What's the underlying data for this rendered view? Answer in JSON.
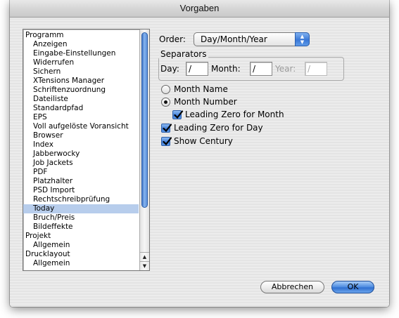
{
  "window": {
    "title": "Vorgaben"
  },
  "list": {
    "items": [
      {
        "label": "Programm",
        "level": 0
      },
      {
        "label": "Anzeigen",
        "level": 1
      },
      {
        "label": "Eingabe-Einstellungen",
        "level": 1
      },
      {
        "label": "Widerrufen",
        "level": 1
      },
      {
        "label": "Sichern",
        "level": 1
      },
      {
        "label": "XTensions Manager",
        "level": 1
      },
      {
        "label": "Schriftenzuordnung",
        "level": 1
      },
      {
        "label": "Dateiliste",
        "level": 1
      },
      {
        "label": "Standardpfad",
        "level": 1
      },
      {
        "label": "EPS",
        "level": 1
      },
      {
        "label": "Voll aufgelöste Voransicht",
        "level": 1
      },
      {
        "label": "Browser",
        "level": 1
      },
      {
        "label": "Index",
        "level": 1
      },
      {
        "label": "Jabberwocky",
        "level": 1
      },
      {
        "label": "Job Jackets",
        "level": 1
      },
      {
        "label": "PDF",
        "level": 1
      },
      {
        "label": "Platzhalter",
        "level": 1
      },
      {
        "label": "PSD Import",
        "level": 1
      },
      {
        "label": "Rechtschreibprüfung",
        "level": 1
      },
      {
        "label": "Today",
        "level": 1,
        "selected": true
      },
      {
        "label": "Bruch/Preis",
        "level": 1
      },
      {
        "label": "Bildeffekte",
        "level": 1
      },
      {
        "label": "Projekt",
        "level": 0
      },
      {
        "label": "Allgemein",
        "level": 1
      },
      {
        "label": "Drucklayout",
        "level": 0
      },
      {
        "label": "Allgemein",
        "level": 1
      }
    ]
  },
  "order": {
    "label": "Order:",
    "value": "Day/Month/Year"
  },
  "separators": {
    "title": "Separators",
    "day_label": "Day:",
    "day_value": "/",
    "month_label": "Month:",
    "month_value": "/",
    "year_label": "Year:",
    "year_value": "/"
  },
  "options": {
    "month_name": "Month Name",
    "month_number": "Month Number",
    "leading_zero_month": "Leading Zero for Month",
    "leading_zero_day": "Leading Zero for Day",
    "show_century": "Show Century"
  },
  "buttons": {
    "cancel": "Abbrechen",
    "ok": "OK"
  },
  "colors": {
    "selection": "#b7cdec",
    "aqua_blue": "#3a78d6"
  }
}
